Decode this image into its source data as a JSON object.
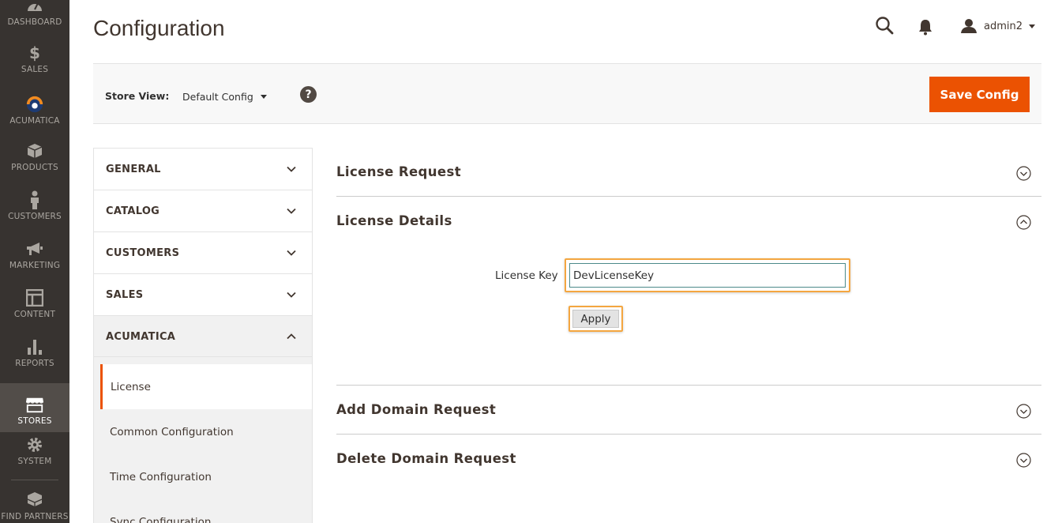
{
  "nav": {
    "items": [
      {
        "label": "DASHBOARD",
        "icon": "dashboard-gauge-icon"
      },
      {
        "label": "SALES",
        "icon": "dollar-icon"
      },
      {
        "label": "ACUMATICA",
        "icon": "acumatica-logo-icon"
      },
      {
        "label": "PRODUCTS",
        "icon": "cube-icon"
      },
      {
        "label": "CUSTOMERS",
        "icon": "person-icon"
      },
      {
        "label": "MARKETING",
        "icon": "megaphone-icon"
      },
      {
        "label": "CONTENT",
        "icon": "layout-icon"
      },
      {
        "label": "REPORTS",
        "icon": "bar-chart-icon"
      },
      {
        "label": "STORES",
        "icon": "storefront-icon"
      },
      {
        "label": "SYSTEM",
        "icon": "gear-icon"
      },
      {
        "label": "FIND PARTNERS",
        "icon": "boxes-icon"
      }
    ],
    "active": "STORES"
  },
  "header": {
    "title": "Configuration",
    "user": "admin2"
  },
  "store_bar": {
    "label": "Store View:",
    "selected": "Default Config",
    "help": "?",
    "save_label": "Save Config"
  },
  "tabs": [
    {
      "label": "GENERAL"
    },
    {
      "label": "CATALOG"
    },
    {
      "label": "CUSTOMERS"
    },
    {
      "label": "SALES"
    },
    {
      "label": "ACUMATICA",
      "open": true,
      "items": [
        "License",
        "Common Configuration",
        "Time Configuration",
        "Sync Configuration"
      ]
    }
  ],
  "sections": {
    "license_request": "License Request",
    "license_details": "License Details",
    "add_domain_request": "Add Domain Request",
    "delete_domain_request": "Delete Domain Request"
  },
  "license_form": {
    "key_label": "License Key",
    "key_value": "DevLicenseKey",
    "apply_label": "Apply"
  },
  "colors": {
    "nav_bg": "#373330",
    "accent": "#eb5202",
    "highlight": "#f4a640"
  }
}
